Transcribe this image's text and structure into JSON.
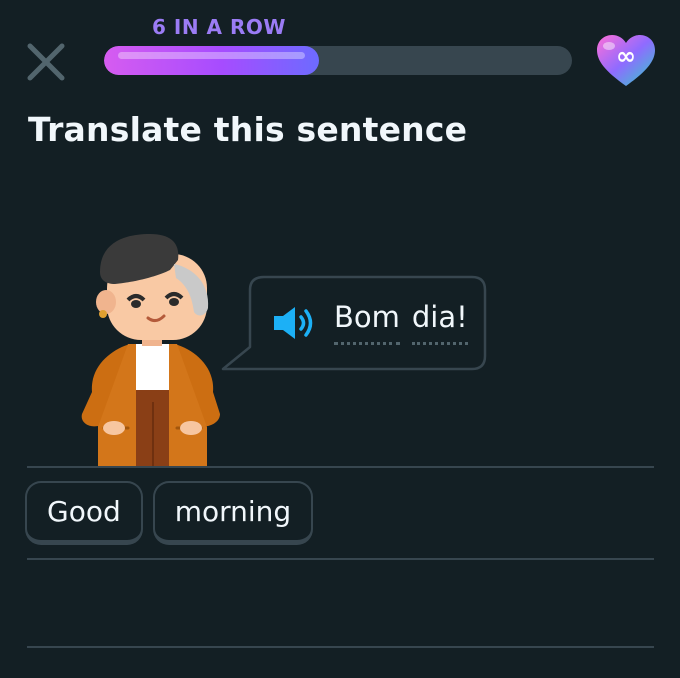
{
  "header": {
    "streak_label": "6 IN A ROW",
    "progress_fraction": 0.46,
    "hearts_symbol": "∞"
  },
  "instruction": "Translate this sentence",
  "prompt": {
    "words": [
      "Bom",
      "dia!"
    ]
  },
  "answer": {
    "tiles": [
      "Good",
      "morning"
    ]
  },
  "colors": {
    "background": "#131f24",
    "track": "#37464f",
    "streak": "#9b7cf5",
    "speaker": "#1cb0f6",
    "text": "#f1f7fb"
  }
}
